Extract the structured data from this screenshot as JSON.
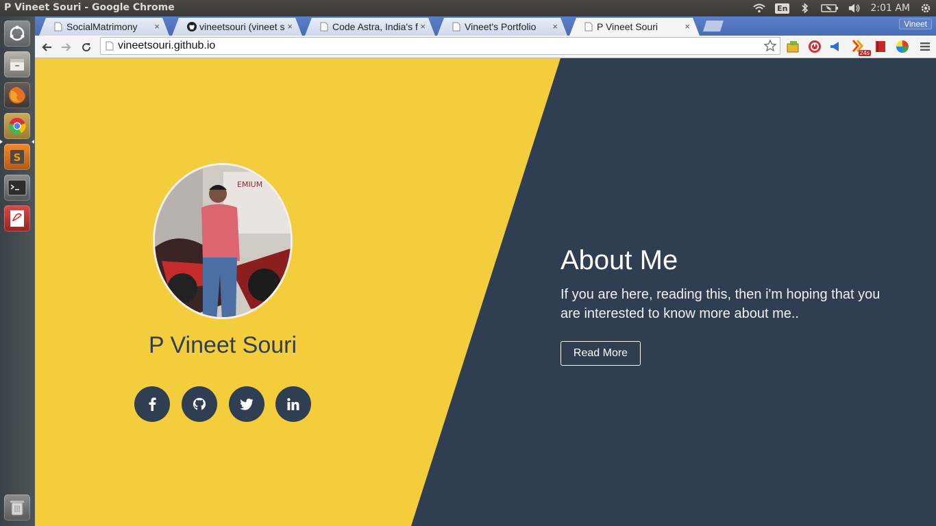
{
  "window": {
    "title": "P Vineet Souri - Google Chrome"
  },
  "panel": {
    "keyboard": "En",
    "clock": "2:01 AM"
  },
  "launcher": {
    "items": [
      "dash-home",
      "files",
      "firefox",
      "chrome",
      "sublime-text",
      "terminal",
      "pdf-viewer",
      "trash"
    ]
  },
  "tabs": [
    {
      "label": "SocialMatrimony",
      "close": "×",
      "active": false
    },
    {
      "label": "vineetsouri (vineet s",
      "close": "×",
      "active": false
    },
    {
      "label": "Code Astra, India's f",
      "close": "×",
      "active": false
    },
    {
      "label": "Vineet's Portfolio",
      "close": "×",
      "active": false
    },
    {
      "label": "P Vineet Souri",
      "close": "×",
      "active": true
    }
  ],
  "profile": {
    "name": "Vineet"
  },
  "toolbar": {
    "url": "vineetsouri.github.io",
    "extension_badge": "24s"
  },
  "page": {
    "name": "P Vineet Souri",
    "social": [
      "facebook",
      "github",
      "twitter",
      "linkedin"
    ],
    "about": {
      "title": "About Me",
      "text": "If you are here, reading this, then i'm hoping that you are interested to know more about me..",
      "button": "Read More"
    }
  },
  "colors": {
    "yellow": "#f4cd3c",
    "navy": "#2f3e50",
    "chrome_blue": "#4b6fb8"
  }
}
